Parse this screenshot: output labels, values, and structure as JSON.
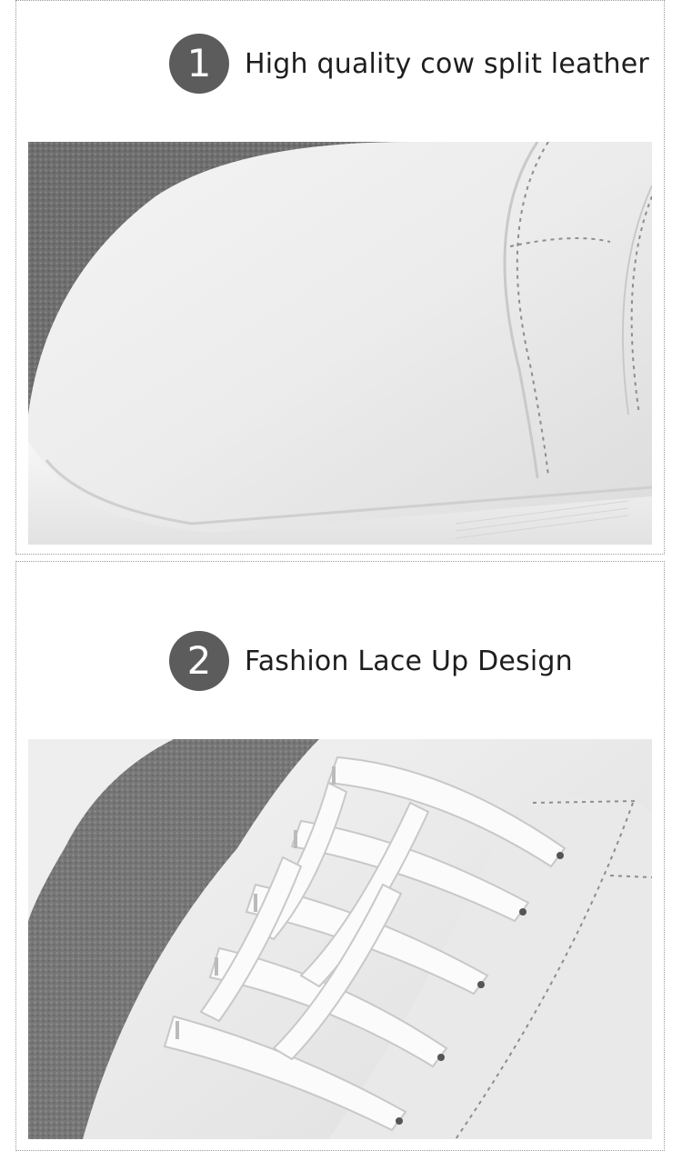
{
  "sections": [
    {
      "number": "1",
      "title": "High quality cow split leather",
      "image": "sneaker-toe-closeup"
    },
    {
      "number": "2",
      "title": "Fashion Lace Up Design",
      "image": "sneaker-laces-closeup"
    }
  ]
}
